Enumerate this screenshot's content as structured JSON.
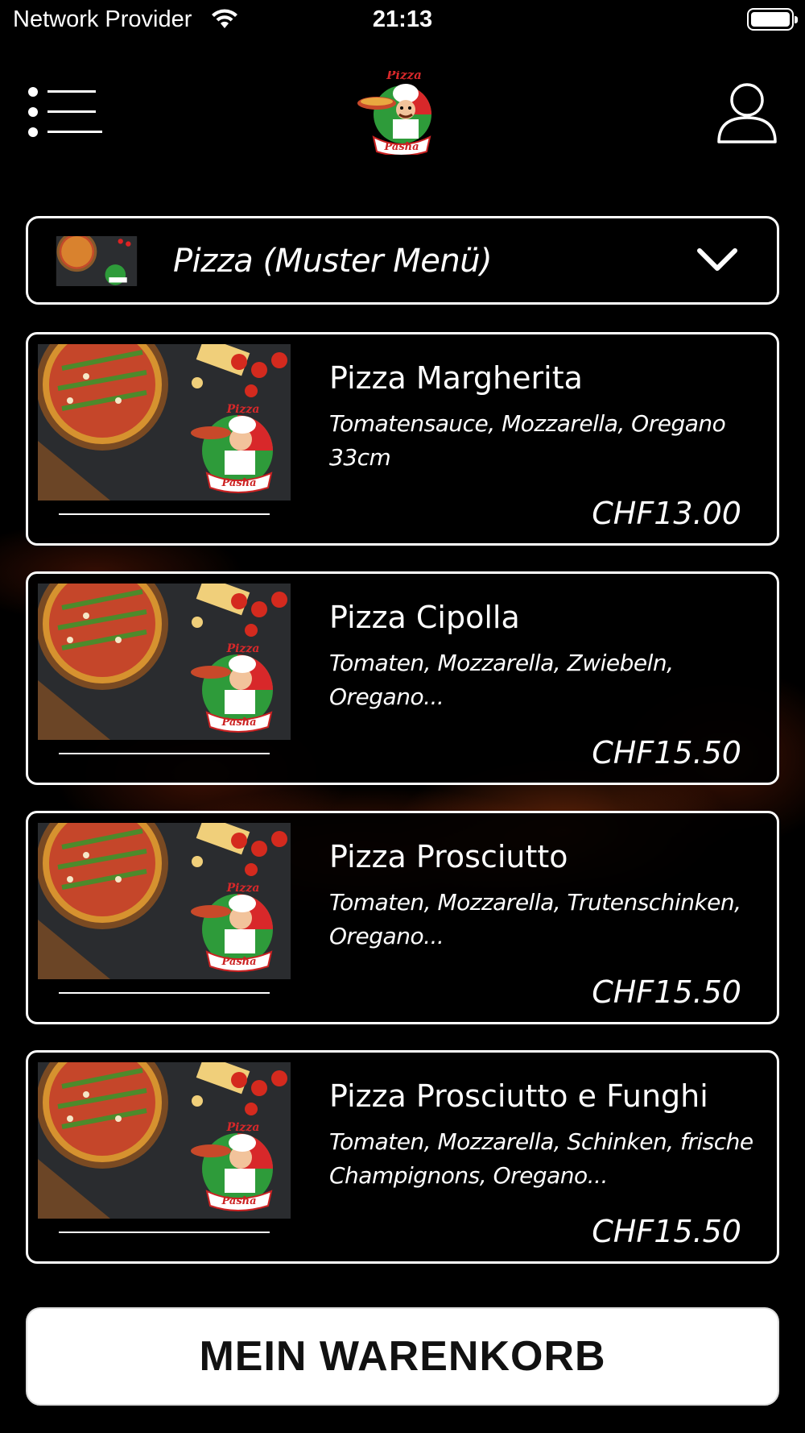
{
  "status_bar": {
    "provider": "Network Provider",
    "time": "21:13"
  },
  "header": {
    "logo_text_top": "Pizza",
    "logo_text_bottom": "Pasha"
  },
  "category": {
    "label": "Pizza (Muster Menü)"
  },
  "products": [
    {
      "name": "Pizza Margherita",
      "description": "Tomatensauce, Mozzarella, Oregano 33cm",
      "price": "CHF13.00"
    },
    {
      "name": "Pizza Cipolla",
      "description": "Tomaten, Mozzarella, Zwiebeln, Oregano...",
      "price": "CHF15.50"
    },
    {
      "name": "Pizza Prosciutto",
      "description": "Tomaten, Mozzarella, Trutenschinken, Oregano...",
      "price": "CHF15.50"
    },
    {
      "name": "Pizza Prosciutto e Funghi",
      "description": "Tomaten, Mozzarella, Schinken, frische Champignons, Oregano...",
      "price": "CHF15.50"
    }
  ],
  "cart_button": {
    "label": "MEIN WARENKORB"
  },
  "colors": {
    "background": "#000000",
    "card_border": "#ffffff",
    "cart_button_bg": "#ffffff",
    "cart_button_text": "#111111"
  }
}
